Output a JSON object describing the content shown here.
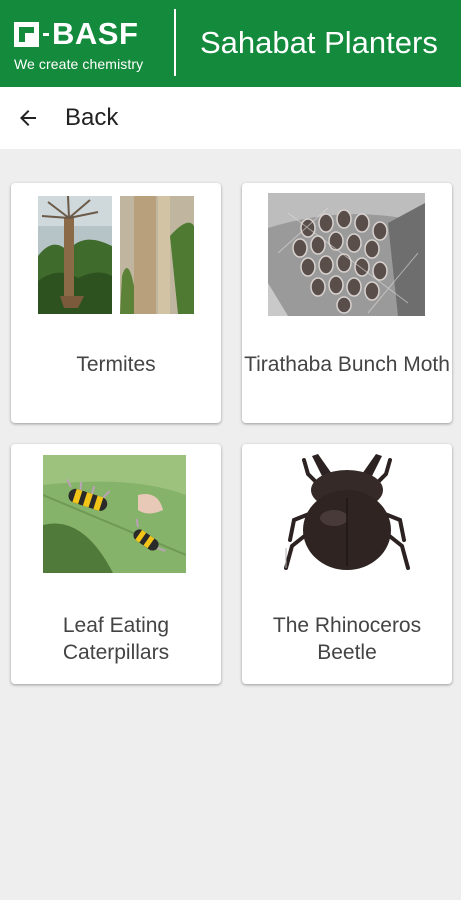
{
  "header": {
    "brand": "BASF",
    "tagline": "We create chemistry",
    "app_title": "Sahabat Planters",
    "bg_color": "#148a3c"
  },
  "nav": {
    "back_label": "Back",
    "back_icon": "arrow-left-icon"
  },
  "cards": [
    {
      "label": "Termites",
      "image": "termite-damaged-palm-photos"
    },
    {
      "label": "Tirathaba Bunch Moth",
      "image": "damaged-fruit-bunch-photo"
    },
    {
      "label": "Leaf Eating Caterpillars",
      "image": "caterpillars-on-leaf-photo"
    },
    {
      "label": "The Rhinoceros Beetle",
      "image": "rhinoceros-beetle-photo"
    }
  ]
}
